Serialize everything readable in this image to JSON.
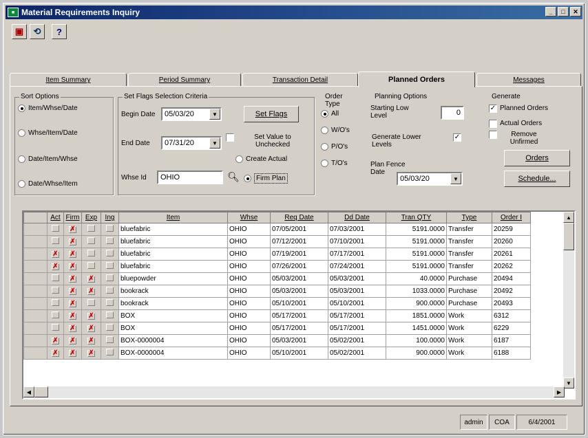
{
  "window": {
    "title": "Material Requirements Inquiry",
    "app_icon": "mrp-app-icon"
  },
  "toolbar": {
    "help": "?"
  },
  "tabs": [
    "Item Summary",
    "Period Summary",
    "Transaction Detail",
    "Planned Orders",
    "Messages"
  ],
  "active_tab": "Planned Orders",
  "sort": {
    "legend": "Sort Options",
    "options": [
      "Item/Whse/Date",
      "Whse/Item/Date",
      "Date/Item/Whse",
      "Date/Whse/Item"
    ],
    "selected": "Item/Whse/Date"
  },
  "flags": {
    "legend": "Set Flags Selection Criteria",
    "begin_label": "Begin Date",
    "begin_value": "05/03/20",
    "end_label": "End Date",
    "end_value": "07/31/20",
    "whse_label": "Whse Id",
    "whse_value": "OHIO",
    "set_flags": "Set Flags",
    "set_value": "Set Value to Unchecked",
    "create_actual": "Create Actual",
    "firm_plan": "Firm Plan"
  },
  "order_type": {
    "legend": "Order Type",
    "options": [
      "All",
      "W/O's",
      "P/O's",
      "T/O's"
    ],
    "selected": "All"
  },
  "planning": {
    "legend": "Planning Options",
    "low_level_label": "Starting Low Level",
    "low_level_value": "0",
    "gen_lower": "Generate Lower Levels",
    "fence_label": "Plan Fence Date",
    "fence_value": "05/03/20"
  },
  "generate": {
    "legend": "Generate",
    "planned": "Planned Orders",
    "actual": "Actual Orders",
    "remove": "Remove Unfirmed",
    "orders_btn": "Orders",
    "schedule_btn": "Schedule..."
  },
  "grid": {
    "columns": [
      "Act",
      "Firm",
      "Exp",
      "Ing",
      "Item",
      "Whse",
      "Req Date",
      "Dd Date",
      "Tran QTY",
      "Type",
      "Order I"
    ],
    "rows": [
      {
        "act": false,
        "firm": true,
        "exp": false,
        "ing": false,
        "item": "bluefabric",
        "whse": "OHIO",
        "req": "07/05/2001",
        "dd": "07/03/2001",
        "qty": "5191.0000",
        "type": "Transfer",
        "order": "20259"
      },
      {
        "act": false,
        "firm": true,
        "exp": false,
        "ing": false,
        "item": "bluefabric",
        "whse": "OHIO",
        "req": "07/12/2001",
        "dd": "07/10/2001",
        "qty": "5191.0000",
        "type": "Transfer",
        "order": "20260"
      },
      {
        "act": true,
        "firm": true,
        "exp": false,
        "ing": false,
        "item": "bluefabric",
        "whse": "OHIO",
        "req": "07/19/2001",
        "dd": "07/17/2001",
        "qty": "5191.0000",
        "type": "Transfer",
        "order": "20261"
      },
      {
        "act": true,
        "firm": true,
        "exp": false,
        "ing": false,
        "item": "bluefabric",
        "whse": "OHIO",
        "req": "07/26/2001",
        "dd": "07/24/2001",
        "qty": "5191.0000",
        "type": "Transfer",
        "order": "20262"
      },
      {
        "act": false,
        "firm": true,
        "exp": true,
        "ing": false,
        "item": "bluepowder",
        "whse": "OHIO",
        "req": "05/03/2001",
        "dd": "05/03/2001",
        "qty": "40.0000",
        "type": "Purchase",
        "order": "20494"
      },
      {
        "act": false,
        "firm": true,
        "exp": true,
        "ing": false,
        "item": "bookrack",
        "whse": "OHIO",
        "req": "05/03/2001",
        "dd": "05/03/2001",
        "qty": "1033.0000",
        "type": "Purchase",
        "order": "20492"
      },
      {
        "act": false,
        "firm": true,
        "exp": false,
        "ing": false,
        "item": "bookrack",
        "whse": "OHIO",
        "req": "05/10/2001",
        "dd": "05/10/2001",
        "qty": "900.0000",
        "type": "Purchase",
        "order": "20493"
      },
      {
        "act": false,
        "firm": true,
        "exp": true,
        "ing": false,
        "item": "BOX",
        "whse": "OHIO",
        "req": "05/17/2001",
        "dd": "05/17/2001",
        "qty": "1851.0000",
        "type": "Work",
        "order": "6312"
      },
      {
        "act": false,
        "firm": true,
        "exp": true,
        "ing": false,
        "item": "BOX",
        "whse": "OHIO",
        "req": "05/17/2001",
        "dd": "05/17/2001",
        "qty": "1451.0000",
        "type": "Work",
        "order": "6229"
      },
      {
        "act": true,
        "firm": true,
        "exp": true,
        "ing": false,
        "item": "BOX-0000004",
        "whse": "OHIO",
        "req": "05/03/2001",
        "dd": "05/02/2001",
        "qty": "100.0000",
        "type": "Work",
        "order": "6187"
      },
      {
        "act": true,
        "firm": true,
        "exp": true,
        "ing": false,
        "item": "BOX-0000004",
        "whse": "OHIO",
        "req": "05/10/2001",
        "dd": "05/02/2001",
        "qty": "900.0000",
        "type": "Work",
        "order": "6188"
      }
    ]
  },
  "status": {
    "user": "admin",
    "company": "COA",
    "date": "6/4/2001"
  }
}
